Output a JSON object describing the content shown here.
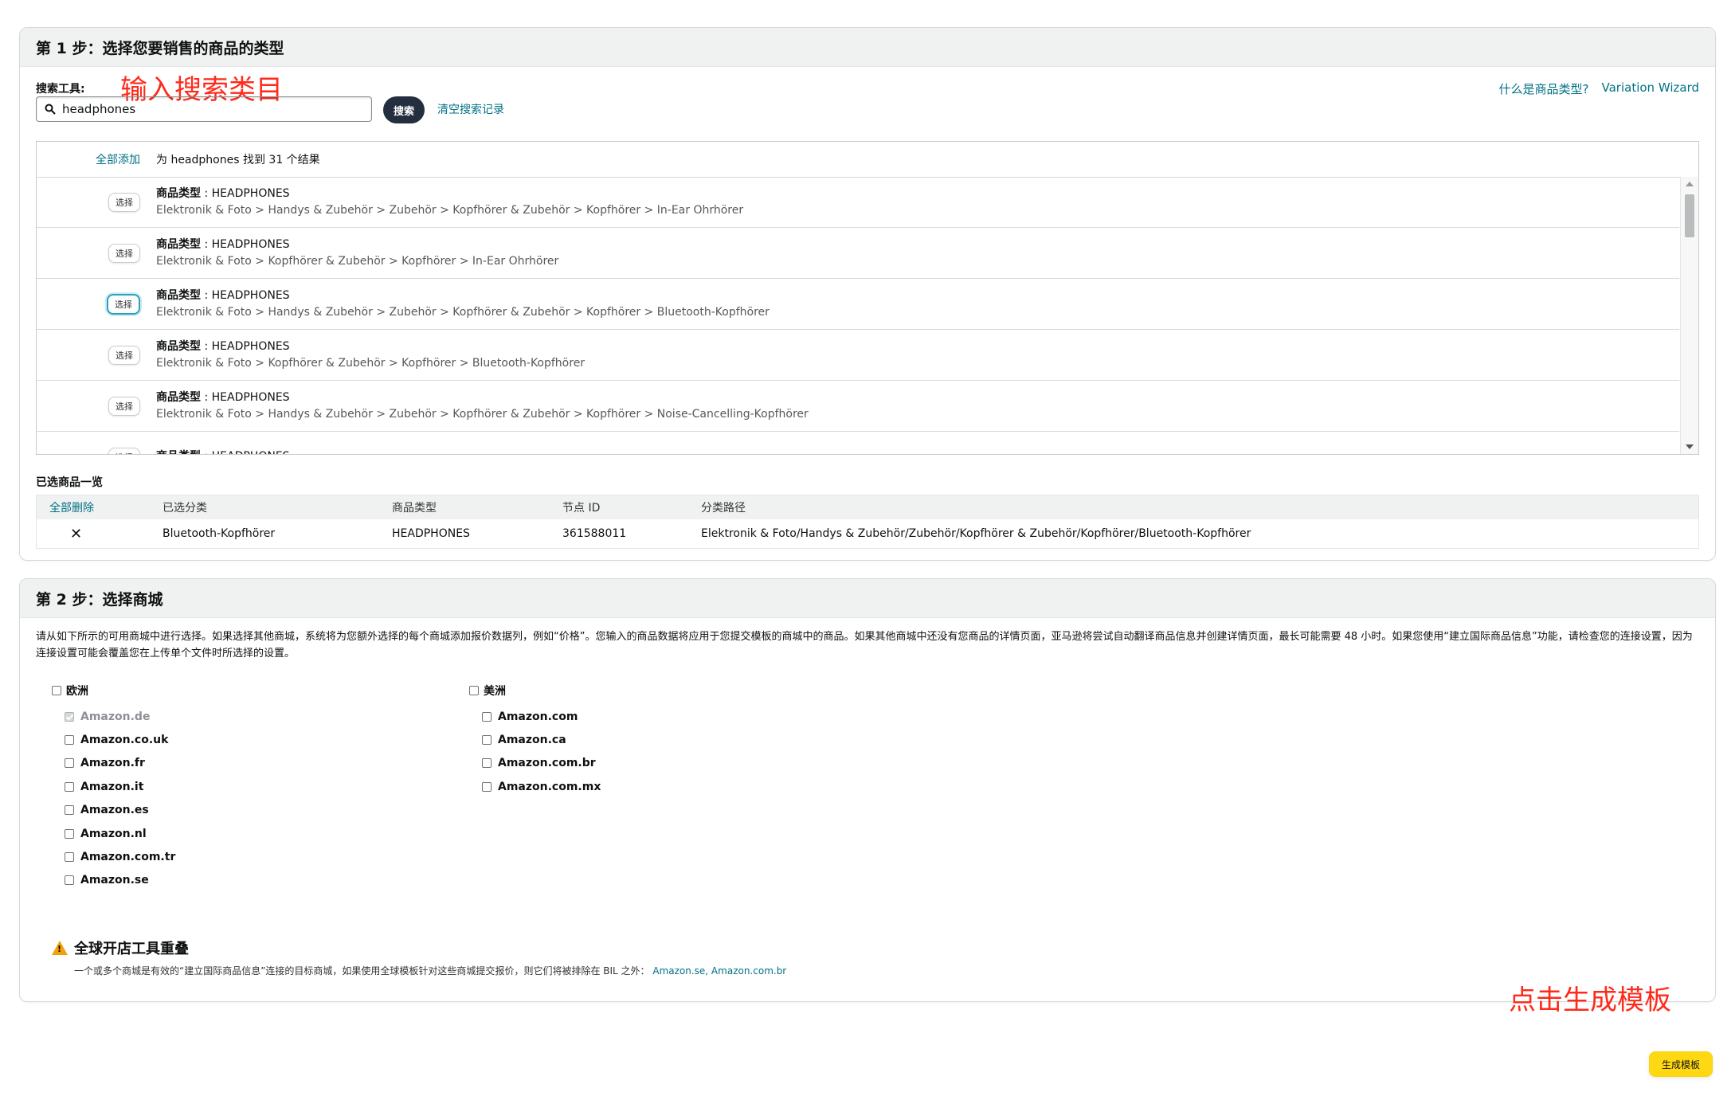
{
  "step1": {
    "title": "第 1 步：选择您要销售的商品的类型",
    "tool_label": "搜索工具:",
    "annotation": "输入搜索类目",
    "search_value": "headphones",
    "search_button": "搜索",
    "clear_history": "清空搜索记录",
    "help_link": "什么是商品类型?",
    "wizard_link": "Variation Wizard",
    "results": {
      "add_all": "全部添加",
      "summary": "为 headphones 找到 31 个结果",
      "select_label": "选择",
      "type_key": "商品类型",
      "items": [
        {
          "type": "HEADPHONES",
          "path": "Elektronik & Foto > Handys & Zubehör > Zubehör > Kopfhörer & Zubehör > Kopfhörer > In-Ear Ohrhörer"
        },
        {
          "type": "HEADPHONES",
          "path": "Elektronik & Foto > Kopfhörer & Zubehör > Kopfhörer > In-Ear Ohrhörer"
        },
        {
          "type": "HEADPHONES",
          "path": "Elektronik & Foto > Handys & Zubehör > Zubehör > Kopfhörer & Zubehör > Kopfhörer > Bluetooth-Kopfhörer"
        },
        {
          "type": "HEADPHONES",
          "path": "Elektronik & Foto > Kopfhörer & Zubehör > Kopfhörer > Bluetooth-Kopfhörer"
        },
        {
          "type": "HEADPHONES",
          "path": "Elektronik & Foto > Handys & Zubehör > Zubehör > Kopfhörer & Zubehör > Kopfhörer > Noise-Cancelling-Kopfhörer"
        },
        {
          "type": "HEADPHONES",
          "path": ""
        }
      ]
    },
    "selected": {
      "title": "已选商品一览",
      "headers": [
        "全部删除",
        "已选分类",
        "商品类型",
        "节点 ID",
        "分类路径"
      ],
      "row": {
        "remove": "✕",
        "category": "Bluetooth-Kopfhörer",
        "type": "HEADPHONES",
        "node_id": "361588011",
        "path": "Elektronik & Foto/Handys & Zubehör/Zubehör/Kopfhörer & Zubehör/Kopfhörer/Bluetooth-Kopfhörer"
      }
    }
  },
  "step2": {
    "title": "第 2 步：选择商城",
    "description": "请从如下所示的可用商城中进行选择。如果选择其他商城，系统将为您额外选择的每个商城添加报价数据列，例如“价格”。您输入的商品数据将应用于您提交模板的商城中的商品。如果其他商城中还没有您商品的详情页面，亚马逊将尝试自动翻译商品信息并创建详情页面，最长可能需要 48 小时。如果您使用“建立国际商品信息”功能，请检查您的连接设置，因为连接设置可能会覆盖您在上传单个文件时所选择的设置。",
    "europe_label": "欧洲",
    "america_label": "美洲",
    "europe_markets": [
      "Amazon.de",
      "Amazon.co.uk",
      "Amazon.fr",
      "Amazon.it",
      "Amazon.es",
      "Amazon.nl",
      "Amazon.com.tr",
      "Amazon.se"
    ],
    "america_markets": [
      "Amazon.com",
      "Amazon.ca",
      "Amazon.com.br",
      "Amazon.com.mx"
    ],
    "warning_title": "全球开店工具重叠",
    "warning_text": "一个或多个商城是有效的“建立国际商品信息”连接的目标商城，如果使用全球模板针对这些商城提交报价，则它们将被排除在 BIL 之外：",
    "warning_links": "Amazon.se, Amazon.com.br"
  },
  "footer": {
    "annotation": "点击生成模板",
    "generate_button": "生成模板"
  },
  "colors": {
    "link": "#007185",
    "annotation": "#ff2a1a",
    "primary_button": "#ffd814",
    "search_button": "#232f3e"
  }
}
